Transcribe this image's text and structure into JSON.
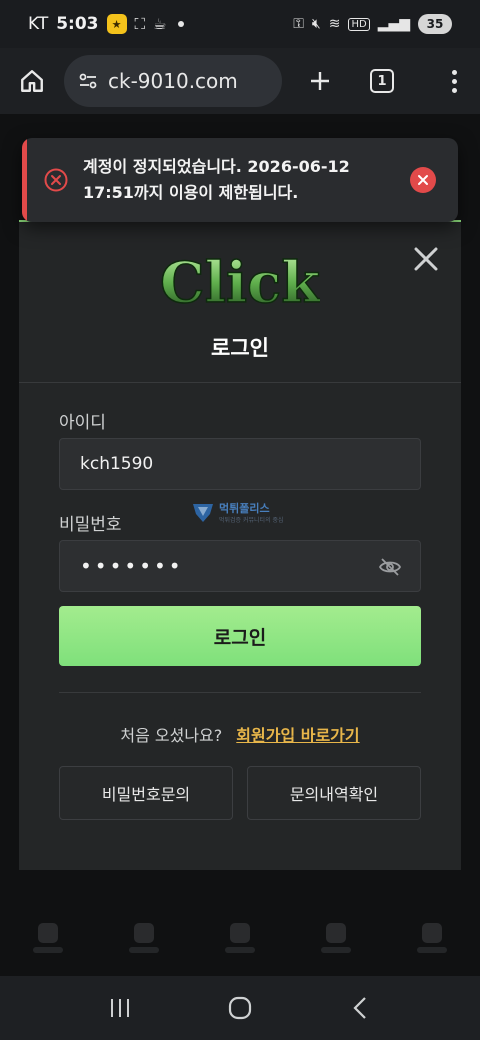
{
  "status_bar": {
    "carrier": "KT",
    "time": "5:03",
    "battery": "35"
  },
  "browser": {
    "url": "ck-9010.com",
    "tab_count": "1"
  },
  "toast": {
    "message": "계정이 정지되었습니다. 2026-06-12 17:51까지 이용이 제한됩니다.",
    "accent_color": "#e24a4a"
  },
  "modal": {
    "logo_text": "Click",
    "title": "로그인",
    "id_label": "아이디",
    "id_value": "kch1590",
    "password_label": "비밀번호",
    "password_value": "•••••••",
    "login_button": "로그인",
    "signup_question": "처음 오셨나요?",
    "signup_link": "회원가입 바로가기",
    "password_inquiry_button": "비밀번호문의",
    "inquiry_history_button": "문의내역확인",
    "accent_color": "#8fe07e"
  },
  "watermark": {
    "title": "먹튀폴리스",
    "subtitle": "먹튀검증 커뮤니티의 중심"
  }
}
